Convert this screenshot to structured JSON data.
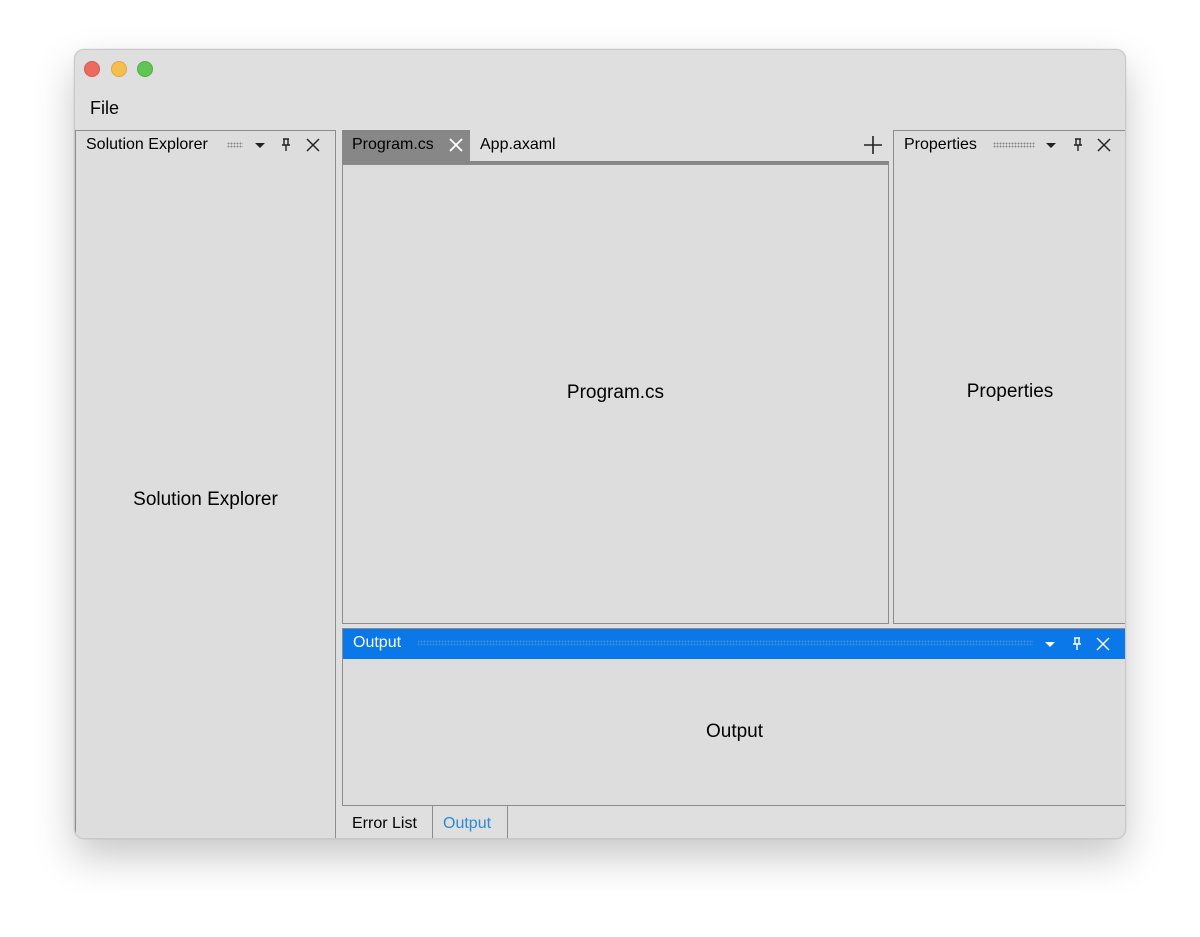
{
  "menu": {
    "file": "File"
  },
  "solution_explorer": {
    "title": "Solution Explorer",
    "body": "Solution Explorer"
  },
  "document": {
    "tabs": [
      {
        "label": "Program.cs",
        "active": true
      },
      {
        "label": "App.axaml",
        "active": false
      }
    ],
    "body": "Program.cs"
  },
  "properties": {
    "title": "Properties",
    "body": "Properties"
  },
  "output": {
    "title": "Output",
    "body": "Output",
    "header_color": "#0a78e8"
  },
  "bottom_tabs": [
    {
      "label": "Error List",
      "active": false
    },
    {
      "label": "Output",
      "active": true
    }
  ],
  "icons": {
    "window_controls": [
      "close-window-icon",
      "minimize-window-icon",
      "maximize-window-icon"
    ],
    "panel_header": [
      "chevron-down-icon",
      "pin-icon",
      "close-icon"
    ],
    "document": [
      "close-icon",
      "plus-icon"
    ]
  }
}
